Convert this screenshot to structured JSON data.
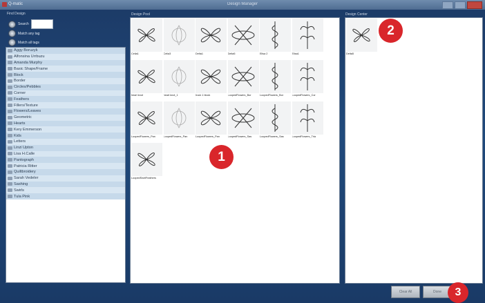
{
  "window": {
    "app_title": "Q-matic",
    "title": "Design Manager"
  },
  "left": {
    "section_label": "Find Design",
    "search_label": "Search",
    "match_any_label": "Match any tag",
    "match_all_label": "Match all tags",
    "folders": [
      "Aggy Boruzyk",
      "Alfonsina Urrbuzu",
      "Amanda Murphy",
      "Basic Shape/Frame",
      "Block",
      "Border",
      "Circles/Pebbles",
      "Corner",
      "Feathers",
      "Fillers/Texture",
      "Flowers/Leaves",
      "Geometric",
      "Hearts",
      "Kery Emmerson",
      "Kids",
      "Letters",
      "Linzi Upton",
      "Lisa H.Calle",
      "Pantograph",
      "Patricia Ritter",
      "Quiltbroidery",
      "Sarah Vedeler",
      "Sashing",
      "Swirls",
      "Tula Pink"
    ]
  },
  "pool": {
    "label": "Design Pool",
    "designs": [
      "Celia1",
      "Celia3",
      "Delta1",
      "Delta5",
      "Elisa 2",
      "Elisa1",
      "heart knot",
      "heart knot_1",
      "Irock 1 block",
      "LoopedFlowers_Bor",
      "LoopedFlowers_Bor",
      "LoopedFlowers_Cor",
      "LoopedFlowers_Pan",
      "LoopedFlowers_Pan",
      "LoopedFlowers_Pan",
      "LoopedFlowers_Sas",
      "LoopedFlowers_Sas",
      "LoopedFlowers_Tria",
      "LoopedSwirlFeathers"
    ]
  },
  "center": {
    "label": "Design Center",
    "designs": [
      "Delta5"
    ]
  },
  "buttons": {
    "clear_all": "Clear All",
    "done": "Done"
  },
  "badges": {
    "one": "1",
    "two": "2",
    "three": "3"
  },
  "colors": {
    "badge": "#d9262b",
    "background": "#1c3a66",
    "list_row": "#c6d9ea"
  },
  "icons": {
    "folder": "folder-icon",
    "radio": "radio-button"
  }
}
